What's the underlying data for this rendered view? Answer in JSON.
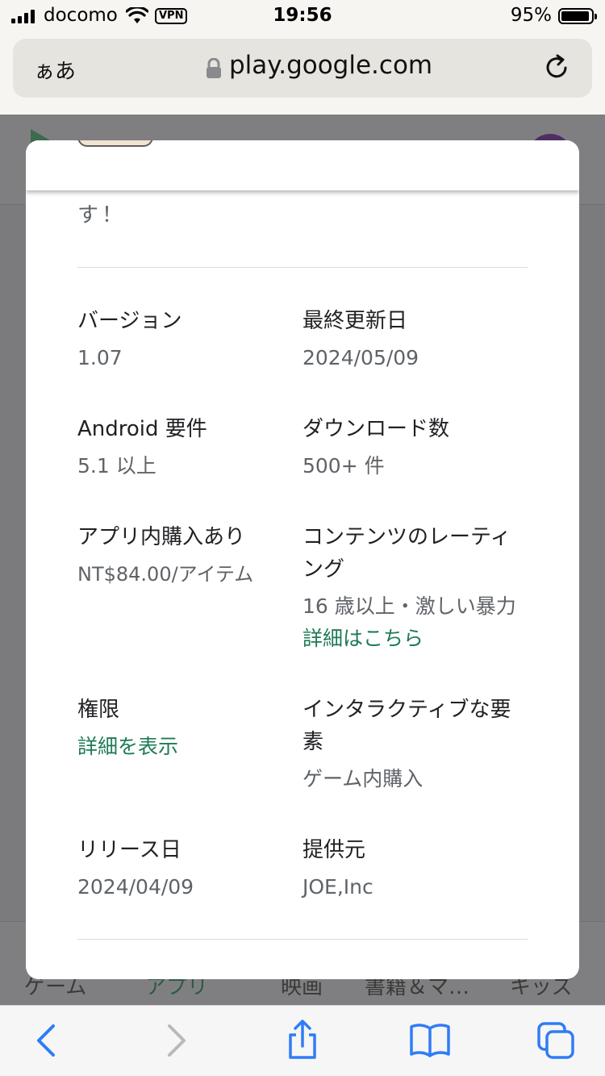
{
  "status_bar": {
    "carrier": "docomo",
    "vpn": "VPN",
    "time": "19:56",
    "battery": "95%"
  },
  "browser": {
    "aa_label": "ぁあ",
    "url": "play.google.com"
  },
  "background_nav": [
    "ゲーム",
    "アプリ",
    "映画",
    "書籍＆マ…",
    "キッズ"
  ],
  "details": {
    "trailing_text": "す！",
    "version": {
      "label": "バージョン",
      "value": "1.07"
    },
    "last_updated": {
      "label": "最終更新日",
      "value": "2024/05/09"
    },
    "android_req": {
      "label": "Android 要件",
      "value": "5.1 以上"
    },
    "downloads": {
      "label": "ダウンロード数",
      "value": "500+ 件"
    },
    "iap": {
      "label": "アプリ内購入あり",
      "value": "NT$84.00/アイテム"
    },
    "rating": {
      "label": "コンテンツのレーティング",
      "value": "16 歳以上・激しい暴力",
      "link": "詳細はこちら"
    },
    "permissions": {
      "label": "権限",
      "link": "詳細を表示"
    },
    "interactive": {
      "label": "インタラクティブな要素",
      "value": "ゲーム内購入"
    },
    "release_date": {
      "label": "リリース日",
      "value": "2024/04/09"
    },
    "provider": {
      "label": "提供元",
      "value": "JOE,Inc"
    }
  },
  "colors": {
    "link_green": "#1e7a55",
    "ios_blue": "#2f7cf6"
  },
  "icons": [
    "wifi-icon",
    "lock-icon",
    "reload-icon",
    "back-icon",
    "forward-icon",
    "share-icon",
    "bookmarks-icon",
    "tabs-icon"
  ]
}
